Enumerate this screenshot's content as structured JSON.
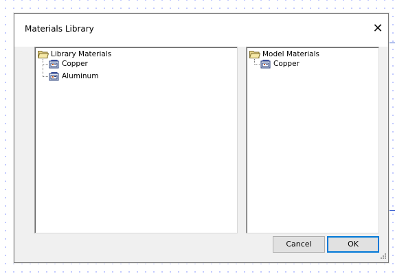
{
  "dialog": {
    "title": "Materials Library",
    "close_glyph": "✕"
  },
  "library_tree": {
    "root_label": "Library Materials",
    "root_icon": "folder-open-icon",
    "items": [
      {
        "label": "Copper",
        "icon": "material-icon"
      },
      {
        "label": "Aluminum",
        "icon": "material-icon"
      }
    ]
  },
  "model_tree": {
    "root_label": "Model Materials",
    "root_icon": "folder-open-icon",
    "items": [
      {
        "label": "Copper",
        "icon": "material-icon"
      }
    ]
  },
  "buttons": {
    "cancel_label": "Cancel",
    "ok_label": "OK"
  },
  "colors": {
    "grid_dots": "#1f3fff",
    "dialog_bg": "#f0f0f0",
    "ok_border": "#0078d7"
  }
}
